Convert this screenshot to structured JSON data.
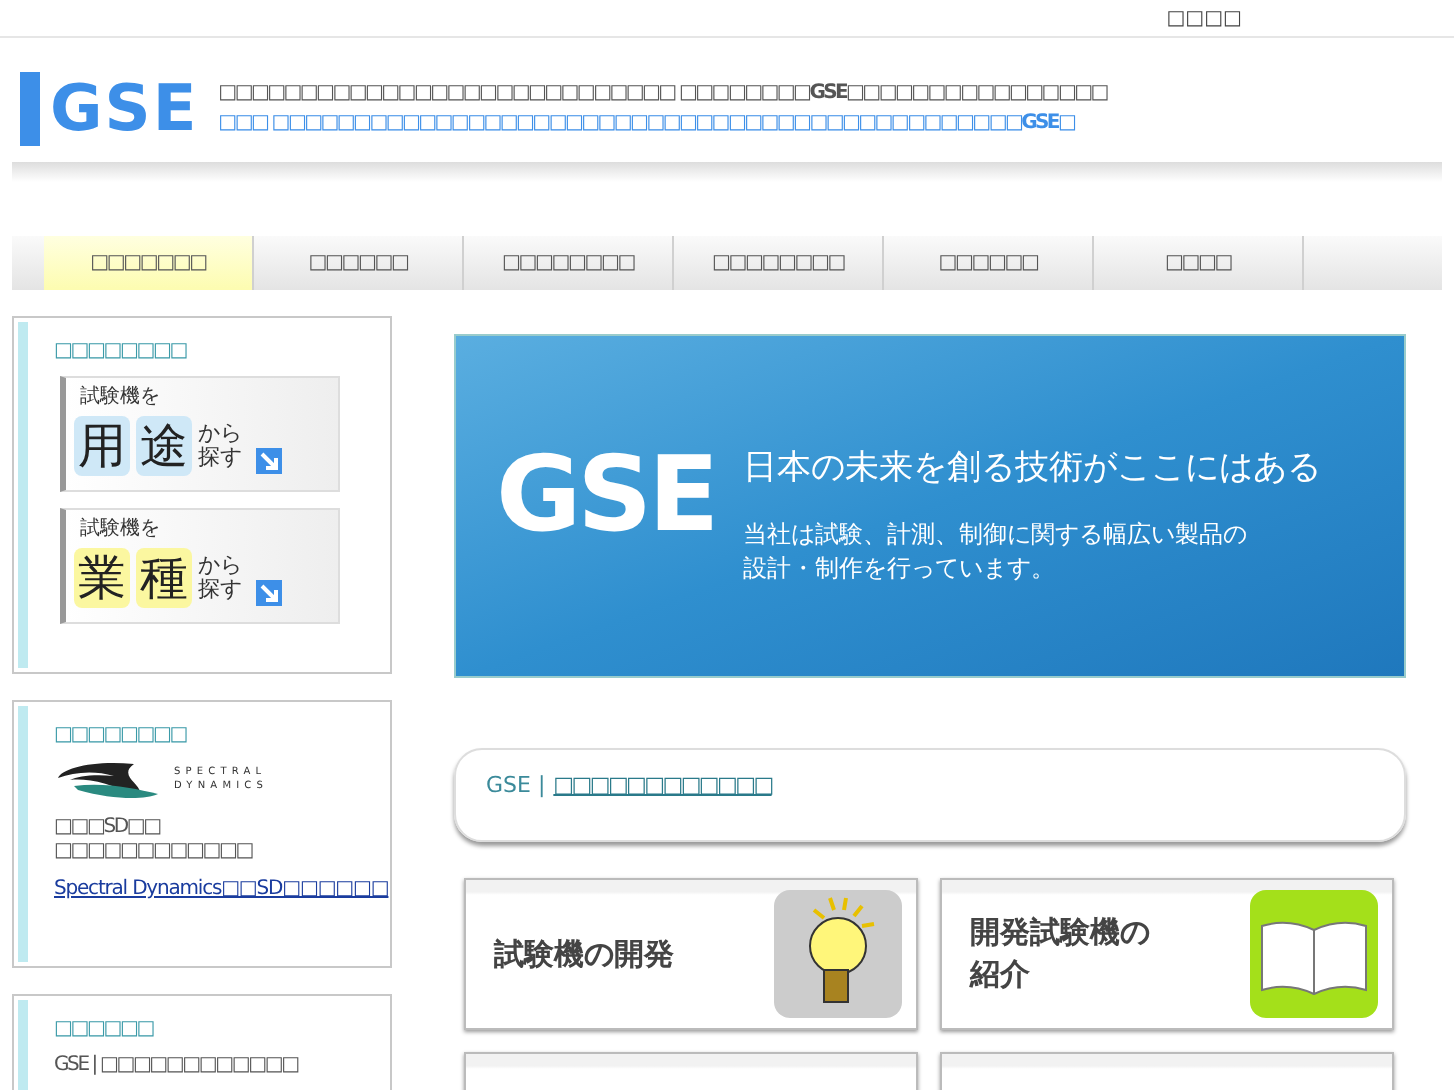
{
  "top_link": "□□□□",
  "header": {
    "logo": "GSE",
    "tagline": "□□□□□□□□□□□□□□□□□□□□□□□□□□□□  □□□□□□□□GSE□□□□□□□□□□□□□□□□",
    "subline": "□□□  □□□□□□□□□□□□□□□□□□□□□□□□□□□□□□□□□□□□□□□□□□□□□□GSE□"
  },
  "nav": [
    {
      "label": "□□□□□□□",
      "selected": true
    },
    {
      "label": "□□□□□□",
      "selected": false
    },
    {
      "label": "□□□□□□□□",
      "selected": false
    },
    {
      "label": "□□□□□□□□",
      "selected": false
    },
    {
      "label": "□□□□□□",
      "selected": false
    },
    {
      "label": "□□□□",
      "selected": false
    }
  ],
  "sidebar": [
    {
      "kind": "search",
      "title": "□□□□□□□□",
      "banners": [
        {
          "lead": "試験機を",
          "chars": [
            "用",
            "途"
          ],
          "tail": "から探す",
          "color": "#cfe8f7"
        },
        {
          "lead": "試験機を",
          "chars": [
            "業",
            "種"
          ],
          "tail": "から探す",
          "color": "#fbf7a0"
        }
      ]
    },
    {
      "kind": "partner",
      "title": "□□□□□□□□",
      "logo": "SPECTRAL DYNAMICS",
      "lines": [
        "□□□SD□□",
        "□□□□□□□□□□□□"
      ],
      "link": "Spectral Dynamics□□SD□□□□□□"
    },
    {
      "kind": "news",
      "title": "□□□□□□",
      "lines": [
        "GSE | □□□□□□□□□□□□"
      ]
    }
  ],
  "hero": {
    "mark": "GSE",
    "headline": "日本の未来を創る技術がここにはある",
    "body": [
      "当社は試験、計測、制御に関する幅広い製品の",
      "設計・制作を行っています。"
    ]
  },
  "intro": {
    "site": "GSE |",
    "link": "□□□□□□□□□□□□"
  },
  "tiles": [
    {
      "kind": "bulb",
      "label": [
        "試験機の開発"
      ]
    },
    {
      "kind": "book",
      "label": [
        "開発試験機の",
        "紹介"
      ]
    },
    {
      "kind": "blank"
    },
    {
      "kind": "blank"
    }
  ]
}
